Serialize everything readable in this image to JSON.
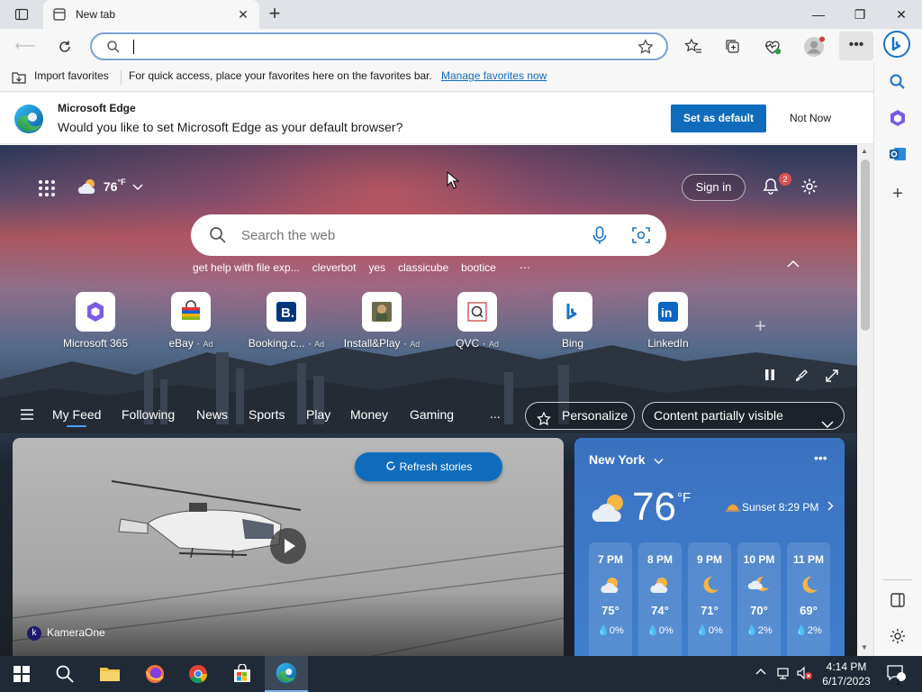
{
  "browser": {
    "tab": {
      "title": "New tab"
    },
    "address": {
      "value": "",
      "placeholder": ""
    },
    "favorites_bar": {
      "import_label": "Import favorites",
      "message": "For quick access, place your favorites here on the favorites bar.",
      "manage_link": "Manage favorites now"
    },
    "default_banner": {
      "title": "Microsoft Edge",
      "message": "Would you like to set Microsoft Edge as your default browser?",
      "primary_button": "Set as default",
      "secondary_button": "Not Now"
    }
  },
  "newtab": {
    "weather_mini": {
      "temp": "76",
      "unit": "°F"
    },
    "signin": "Sign in",
    "notifications_count": "2",
    "search": {
      "placeholder": "Search the web"
    },
    "quick_searches": [
      "get help with file exp...",
      "cleverbot",
      "yes",
      "classicube",
      "bootice"
    ],
    "tiles": [
      {
        "label": "Microsoft 365",
        "ad": ""
      },
      {
        "label": "eBay",
        "ad": "Ad"
      },
      {
        "label": "Booking.c...",
        "ad": "Ad"
      },
      {
        "label": "Install&Play",
        "ad": "Ad"
      },
      {
        "label": "QVC",
        "ad": "Ad"
      },
      {
        "label": "Bing",
        "ad": ""
      },
      {
        "label": "LinkedIn",
        "ad": ""
      }
    ],
    "feed_nav": {
      "items": [
        "My Feed",
        "Following",
        "News",
        "Sports",
        "Play",
        "Money",
        "Gaming"
      ],
      "more": "...",
      "personalize": "Personalize",
      "visibility": "Content partially visible"
    },
    "story": {
      "refresh_label": "Refresh stories",
      "source": "KameraOne",
      "source_initial": "k"
    },
    "weather": {
      "city": "New York",
      "temp": "76",
      "unit": "°F",
      "sunset": "Sunset 8:29 PM",
      "hourly": [
        {
          "time": "7 PM",
          "temp": "75°",
          "precip": "0%",
          "icon": "partly-cloudy-sun"
        },
        {
          "time": "8 PM",
          "temp": "74°",
          "precip": "0%",
          "icon": "partly-cloudy-sun"
        },
        {
          "time": "9 PM",
          "temp": "71°",
          "precip": "0%",
          "icon": "moon"
        },
        {
          "time": "10 PM",
          "temp": "70°",
          "precip": "2%",
          "icon": "partly-cloudy-moon"
        },
        {
          "time": "11 PM",
          "temp": "69°",
          "precip": "2%",
          "icon": "moon"
        }
      ]
    }
  },
  "taskbar": {
    "time": "4:14 PM",
    "date": "6/17/2023",
    "notification_count": "1"
  },
  "colors": {
    "accent": "#0f6cbd",
    "taskbar": "#1f2a36",
    "weather_card": "#3f7fcd"
  }
}
